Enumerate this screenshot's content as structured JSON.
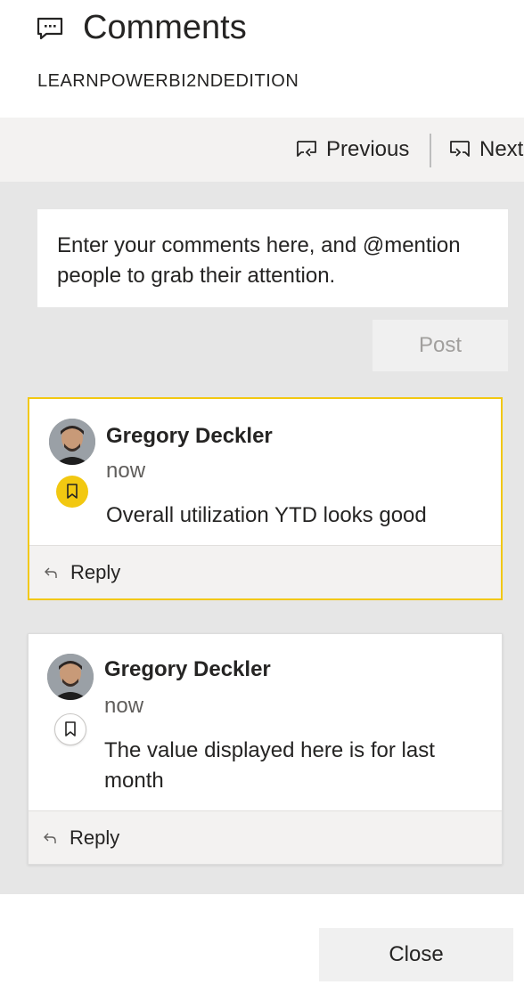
{
  "header": {
    "title": "Comments",
    "subtitle": "LEARNPOWERBI2NDEDITION",
    "title_icon": "comment-icon"
  },
  "nav": {
    "previous_label": "Previous",
    "next_label": "Next",
    "previous_icon": "comment-previous-icon",
    "next_icon": "comment-next-icon"
  },
  "composer": {
    "placeholder": "Enter your comments here, and @mention people to grab their attention.",
    "post_label": "Post"
  },
  "comments": [
    {
      "author": "Gregory Deckler",
      "time": "now",
      "text": "Overall utilization YTD looks good",
      "bookmarked": true,
      "reply_label": "Reply"
    },
    {
      "author": "Gregory Deckler",
      "time": "now",
      "text": "The value displayed here is for last month",
      "bookmarked": false,
      "reply_label": "Reply"
    }
  ],
  "footer": {
    "close_label": "Close"
  },
  "colors": {
    "accent": "#f2c811",
    "panel": "#e6e6e6",
    "bar": "#f3f2f1"
  }
}
